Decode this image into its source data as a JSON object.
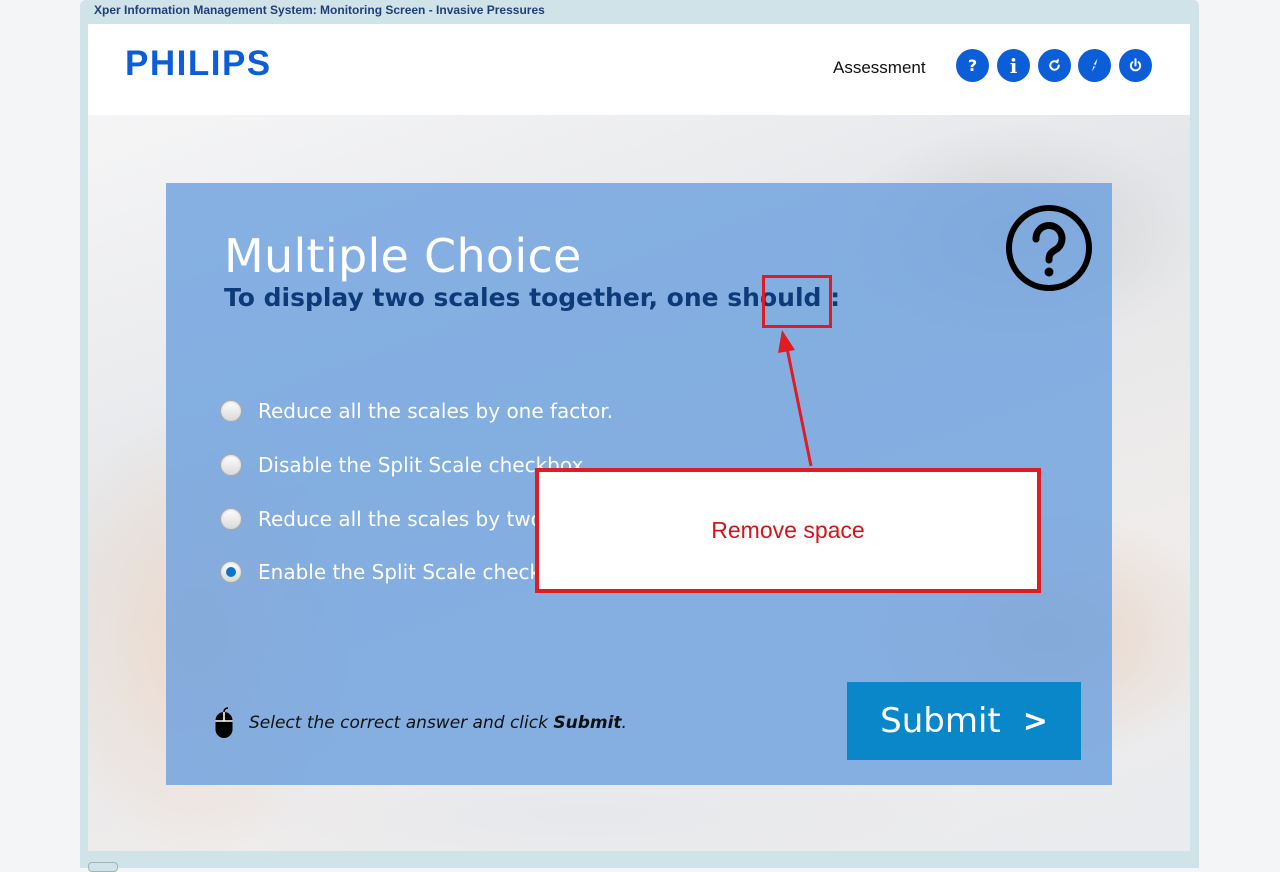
{
  "window": {
    "title": "Xper Information Management System: Monitoring Screen - Invasive Pressures"
  },
  "header": {
    "logo": "PHILIPS",
    "section_label": "Assessment",
    "buttons": [
      {
        "name": "help",
        "glyph": "?"
      },
      {
        "name": "info",
        "glyph": "i"
      },
      {
        "name": "replay",
        "icon": "refresh-icon"
      },
      {
        "name": "glossary",
        "icon": "compass-icon"
      },
      {
        "name": "exit",
        "icon": "power-icon"
      }
    ]
  },
  "question": {
    "type_title": "Multiple Choice",
    "prompt": "To display two scales together, one should :",
    "options": [
      {
        "label": "Reduce all the scales by one factor.",
        "selected": false
      },
      {
        "label": "Disable the Split Scale checkbox.",
        "selected": false
      },
      {
        "label": "Reduce all the scales by two factors.",
        "selected": false
      },
      {
        "label": "Enable the Split Scale checkbox.",
        "selected": true
      }
    ],
    "instruction_prefix": "Select the correct answer and click ",
    "instruction_bold": "Submit",
    "instruction_suffix": ".",
    "submit_label": "Submit",
    "submit_chevron": ">"
  },
  "annotation": {
    "callout_text": "Remove space",
    "color": "#e11b22"
  },
  "colors": {
    "brand_blue": "#0b5ed7",
    "panel_blue": "#689ede",
    "submit_blue": "#0a87c9",
    "question_navy": "#0d3a78"
  }
}
